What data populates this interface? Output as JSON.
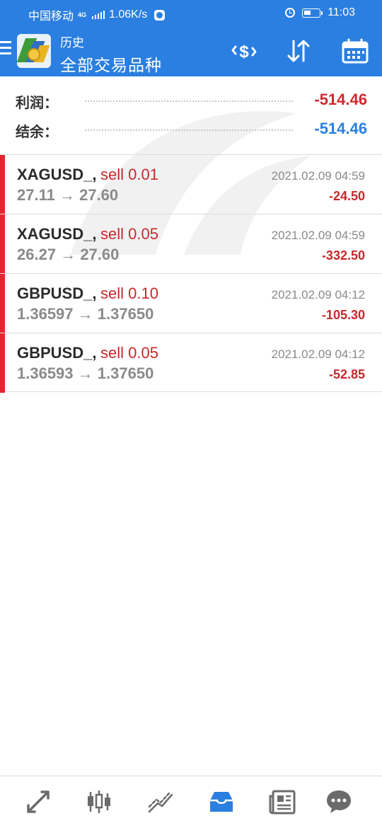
{
  "status_bar": {
    "carrier": "中国移动",
    "network_type": "4G",
    "speed": "1.06K/s",
    "time": "11:03"
  },
  "header": {
    "subtitle": "历史",
    "title": "全部交易品种",
    "icons": [
      "menu-icon",
      "app-logo",
      "currency-swap-icon",
      "sort-icon",
      "calendar-icon"
    ]
  },
  "summary": {
    "profit_label": "利润：",
    "profit_value": "-514.46",
    "balance_label": "结余：",
    "balance_value": "-514.46"
  },
  "trades": [
    {
      "symbol": "XAGUSD_,",
      "side": "sell 0.01",
      "open": "27.11",
      "arrow": "→",
      "close": "27.60",
      "time": "2021.02.09 04:59",
      "profit": "-24.50"
    },
    {
      "symbol": "XAGUSD_,",
      "side": "sell 0.05",
      "open": "26.27",
      "arrow": "→",
      "close": "27.60",
      "time": "2021.02.09 04:59",
      "profit": "-332.50"
    },
    {
      "symbol": "GBPUSD_,",
      "side": "sell 0.10",
      "open": "1.36597",
      "arrow": "→",
      "close": "1.37650",
      "time": "2021.02.09 04:12",
      "profit": "-105.30"
    },
    {
      "symbol": "GBPUSD_,",
      "side": "sell 0.05",
      "open": "1.36593",
      "arrow": "→",
      "close": "1.37650",
      "time": "2021.02.09 04:12",
      "profit": "-52.85"
    }
  ],
  "bottom_nav": {
    "items": [
      "quotes-icon",
      "chart-icon",
      "trade-icon",
      "history-icon",
      "news-icon",
      "chat-icon"
    ],
    "active": "history-icon"
  },
  "colors": {
    "header_bg": "#2a7fe0",
    "negative": "#d0282e",
    "balance": "#2a7fe0",
    "sell_bar": "#e3252f",
    "active_nav": "#2a7fe0",
    "inactive_nav": "#6b6b6b"
  }
}
